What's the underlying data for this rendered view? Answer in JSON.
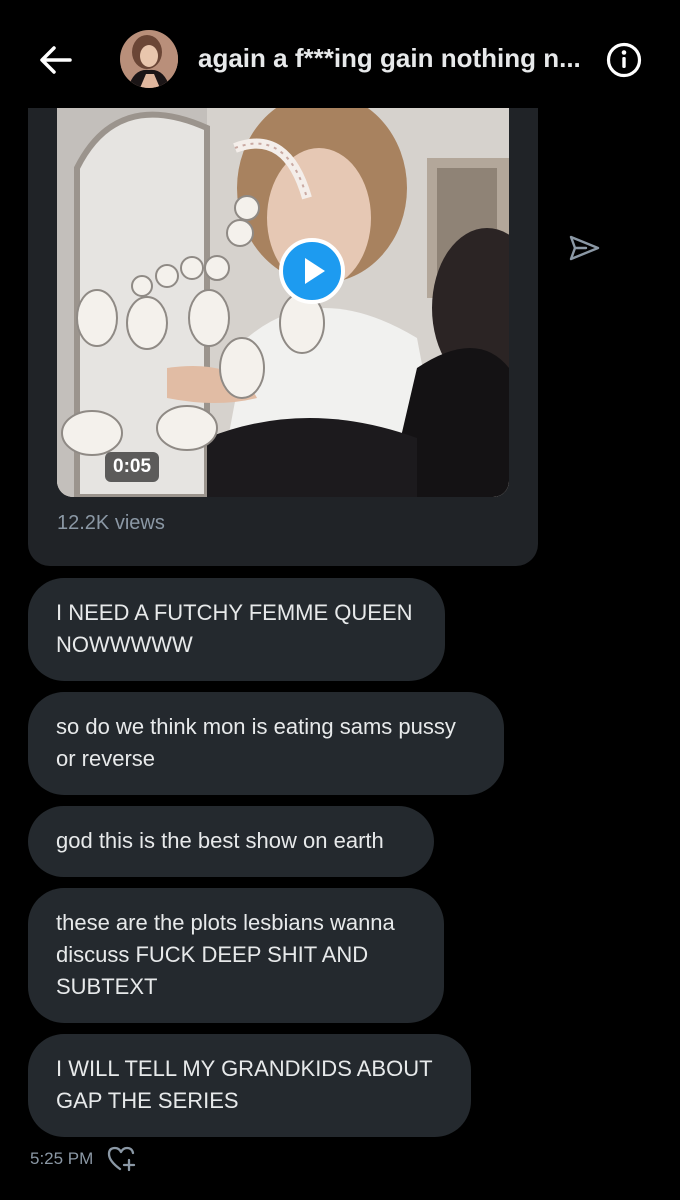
{
  "header": {
    "back_icon": "arrow-left-icon",
    "title": "again a f***ing gain nothing n...",
    "info_icon": "info-circle-icon"
  },
  "media": {
    "duration": "0:05",
    "views": "12.2K views",
    "play_icon": "play-icon",
    "share_icon": "send-icon",
    "accent": "#1d9bf0"
  },
  "messages": [
    {
      "text": "I NEED A FUTCHY FEMME QUEEN\nNOWWWWW"
    },
    {
      "text": "so do we think mon is eating sams pussy\nor reverse"
    },
    {
      "text": "god this is the best show on earth"
    },
    {
      "text": "these are the plots lesbians wanna\ndiscuss FUCK DEEP SHIT AND\nSUBTEXT"
    },
    {
      "text": "I WILL TELL MY GRANDKIDS ABOUT\nGAP THE SERIES"
    }
  ],
  "footer": {
    "timestamp": "5:25 PM",
    "react_icon": "heart-plus-icon"
  },
  "colors": {
    "background": "#000000",
    "bubble": "#24292e",
    "text": "#e7e9ea",
    "muted": "#8b98a5"
  }
}
